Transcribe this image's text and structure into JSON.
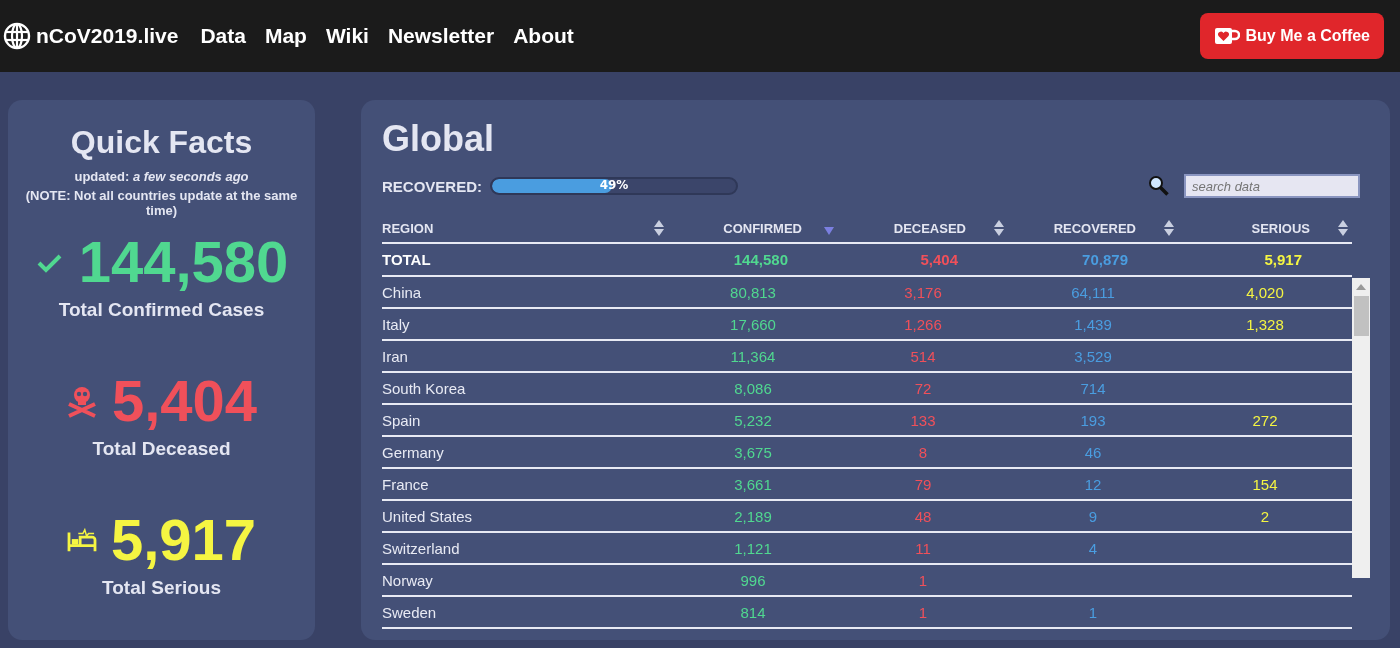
{
  "navbar": {
    "brand": "nCoV2019.live",
    "links": [
      "Data",
      "Map",
      "Wiki",
      "Newsletter",
      "About"
    ],
    "donate_button": "Buy Me a Coffee"
  },
  "quick_facts": {
    "title": "Quick Facts",
    "updated_label": "updated:",
    "updated_value": "a few seconds ago",
    "note": "(NOTE: Not all countries update at the same time)",
    "stats": [
      {
        "kind": "confirmed",
        "value": "144,580",
        "label": "Total Confirmed Cases"
      },
      {
        "kind": "deceased",
        "value": "5,404",
        "label": "Total Deceased"
      },
      {
        "kind": "serious",
        "value": "5,917",
        "label": "Total Serious"
      }
    ]
  },
  "global": {
    "title": "Global",
    "recovered": {
      "label": "RECOVERED:",
      "level": 0.49,
      "text": "49%"
    },
    "search": {
      "placeholder": "search data"
    },
    "table": {
      "columns": [
        {
          "label": "REGION",
          "kind": "region",
          "sorted_desc": false
        },
        {
          "label": "CONFIRMED",
          "kind": "confirmed",
          "sorted_desc": true
        },
        {
          "label": "DECEASED",
          "kind": "deceased",
          "sorted_desc": false
        },
        {
          "label": "RECOVERED",
          "kind": "recovered",
          "sorted_desc": false
        },
        {
          "label": "SERIOUS",
          "kind": "serious",
          "sorted_desc": false
        }
      ],
      "total": [
        "TOTAL",
        "144,580",
        "5,404",
        "70,879",
        "5,917"
      ],
      "rows": [
        [
          "China",
          "80,813",
          "3,176",
          "64,111",
          "4,020"
        ],
        [
          "Italy",
          "17,660",
          "1,266",
          "1,439",
          "1,328"
        ],
        [
          "Iran",
          "11,364",
          "514",
          "3,529",
          null
        ],
        [
          "South Korea",
          "8,086",
          "72",
          "714",
          null
        ],
        [
          "Spain",
          "5,232",
          "133",
          "193",
          "272"
        ],
        [
          "Germany",
          "3,675",
          "8",
          "46",
          null
        ],
        [
          "France",
          "3,661",
          "79",
          "12",
          "154"
        ],
        [
          "United States",
          "2,189",
          "48",
          "9",
          "2"
        ],
        [
          "Switzerland",
          "1,121",
          "11",
          "4",
          null
        ],
        [
          "Norway",
          "996",
          "1",
          null,
          null
        ],
        [
          "Sweden",
          "814",
          "1",
          "1",
          null
        ]
      ]
    }
  }
}
